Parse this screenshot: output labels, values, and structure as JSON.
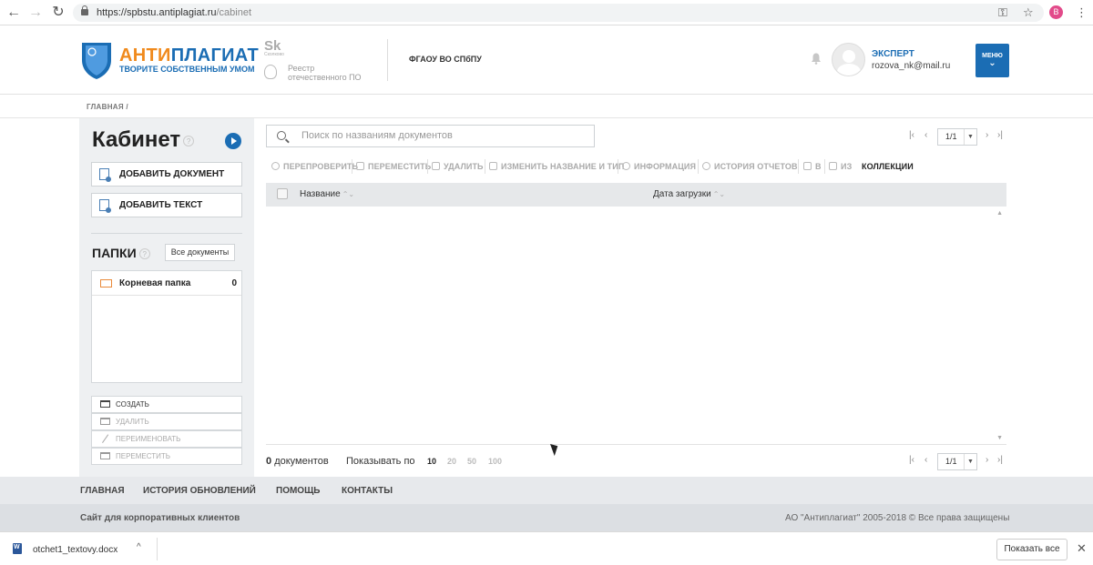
{
  "browser": {
    "url_host": "https://spbstu.antiplagiat.ru",
    "url_path": "/cabinet",
    "profile_initial": "B",
    "icons": [
      "back-arrow-icon",
      "forward-arrow-icon",
      "reload-icon",
      "key-icon",
      "star-icon",
      "kebab-menu-icon"
    ]
  },
  "header": {
    "brand_part1": "АНТИ",
    "brand_part2": "ПЛАГИАТ",
    "tagline": "ТВОРИТЕ СОБСТВЕННЫМ УМОМ",
    "sk_logo": "Sk",
    "sk_sub": "Сколково",
    "reestr_line1": "Реестр",
    "reestr_line2": "отечественного ПО",
    "org": "ФГАОУ ВО СПбПУ",
    "role": "ЭКСПЕРТ",
    "email": "rozova_nk@mail.ru",
    "menu_label": "МЕНЮ",
    "menu_chevron": "⌄",
    "brand_color": "#1b6db4",
    "brand_accent": "#f08a1d"
  },
  "breadcrumb": "ГЛАВНАЯ /",
  "sidebar": {
    "title": "Кабинет",
    "help": "?",
    "add_document": "ДОБАВИТЬ ДОКУМЕНТ",
    "add_text": "ДОБАВИТЬ ТЕКСТ",
    "folders_title": "ПАПКИ",
    "all_documents": "Все документы",
    "folders": [
      {
        "name": "Корневая папка",
        "count": "0"
      }
    ],
    "folder_actions": [
      {
        "label": "СОЗДАТЬ",
        "enabled": true
      },
      {
        "label": "УДАЛИТЬ",
        "enabled": false
      },
      {
        "label": "ПЕРЕИМЕНОВАТЬ",
        "enabled": false
      },
      {
        "label": "ПЕРЕМЕСТИТЬ",
        "enabled": false
      }
    ]
  },
  "main": {
    "search_placeholder": "Поиск по названиям документов",
    "pager": {
      "current": "1/1",
      "first": "|‹",
      "prev": "‹",
      "next": "›",
      "last": "›|"
    },
    "toolbar": {
      "recheck": "ПЕРЕПРОВЕРИТЬ",
      "move": "ПЕРЕМЕСТИТЬ",
      "delete": "УДАЛИТЬ",
      "rename": "ИЗМЕНИТЬ НАЗВАНИЕ И ТИП",
      "info": "ИНФОРМАЦИЯ",
      "history": "ИСТОРИЯ ОТЧЕТОВ",
      "to": "В",
      "from": "ИЗ",
      "collections": "КОЛЛЕКЦИИ"
    },
    "table": {
      "col_name": "Название",
      "col_date": "Дата загрузки",
      "sort_glyph": "⌃⌄",
      "rows": []
    },
    "doc_count": "0",
    "doc_count_label": "документов",
    "show_by_label": "Показывать по",
    "page_sizes": [
      {
        "value": "10",
        "active": true
      },
      {
        "value": "20",
        "active": false
      },
      {
        "value": "50",
        "active": false
      },
      {
        "value": "100",
        "active": false
      }
    ]
  },
  "footer": {
    "nav": [
      "ГЛАВНАЯ",
      "ИСТОРИЯ ОБНОВЛЕНИЙ",
      "ПОМОЩЬ",
      "КОНТАКТЫ"
    ],
    "corp": "Сайт для корпоративных клиентов",
    "copyright": "АО \"Антиплагиат\" 2005-2018 © Все права защищены"
  },
  "downloads": {
    "file": "otchet1_textovy.docx",
    "show_all": "Показать все",
    "chevron": "^",
    "close": "✕"
  }
}
